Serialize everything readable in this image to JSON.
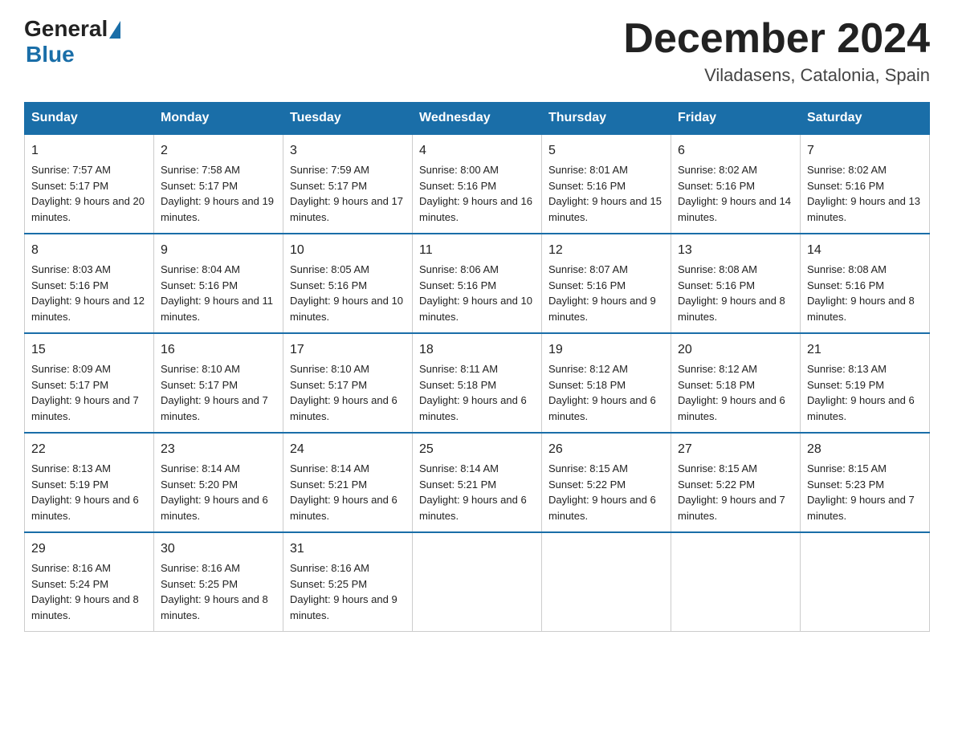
{
  "header": {
    "logo_general": "General",
    "logo_blue": "Blue",
    "month_title": "December 2024",
    "location": "Viladasens, Catalonia, Spain"
  },
  "days_of_week": [
    "Sunday",
    "Monday",
    "Tuesday",
    "Wednesday",
    "Thursday",
    "Friday",
    "Saturday"
  ],
  "weeks": [
    [
      {
        "day": "1",
        "sunrise": "7:57 AM",
        "sunset": "5:17 PM",
        "daylight": "9 hours and 20 minutes."
      },
      {
        "day": "2",
        "sunrise": "7:58 AM",
        "sunset": "5:17 PM",
        "daylight": "9 hours and 19 minutes."
      },
      {
        "day": "3",
        "sunrise": "7:59 AM",
        "sunset": "5:17 PM",
        "daylight": "9 hours and 17 minutes."
      },
      {
        "day": "4",
        "sunrise": "8:00 AM",
        "sunset": "5:16 PM",
        "daylight": "9 hours and 16 minutes."
      },
      {
        "day": "5",
        "sunrise": "8:01 AM",
        "sunset": "5:16 PM",
        "daylight": "9 hours and 15 minutes."
      },
      {
        "day": "6",
        "sunrise": "8:02 AM",
        "sunset": "5:16 PM",
        "daylight": "9 hours and 14 minutes."
      },
      {
        "day": "7",
        "sunrise": "8:02 AM",
        "sunset": "5:16 PM",
        "daylight": "9 hours and 13 minutes."
      }
    ],
    [
      {
        "day": "8",
        "sunrise": "8:03 AM",
        "sunset": "5:16 PM",
        "daylight": "9 hours and 12 minutes."
      },
      {
        "day": "9",
        "sunrise": "8:04 AM",
        "sunset": "5:16 PM",
        "daylight": "9 hours and 11 minutes."
      },
      {
        "day": "10",
        "sunrise": "8:05 AM",
        "sunset": "5:16 PM",
        "daylight": "9 hours and 10 minutes."
      },
      {
        "day": "11",
        "sunrise": "8:06 AM",
        "sunset": "5:16 PM",
        "daylight": "9 hours and 10 minutes."
      },
      {
        "day": "12",
        "sunrise": "8:07 AM",
        "sunset": "5:16 PM",
        "daylight": "9 hours and 9 minutes."
      },
      {
        "day": "13",
        "sunrise": "8:08 AM",
        "sunset": "5:16 PM",
        "daylight": "9 hours and 8 minutes."
      },
      {
        "day": "14",
        "sunrise": "8:08 AM",
        "sunset": "5:16 PM",
        "daylight": "9 hours and 8 minutes."
      }
    ],
    [
      {
        "day": "15",
        "sunrise": "8:09 AM",
        "sunset": "5:17 PM",
        "daylight": "9 hours and 7 minutes."
      },
      {
        "day": "16",
        "sunrise": "8:10 AM",
        "sunset": "5:17 PM",
        "daylight": "9 hours and 7 minutes."
      },
      {
        "day": "17",
        "sunrise": "8:10 AM",
        "sunset": "5:17 PM",
        "daylight": "9 hours and 6 minutes."
      },
      {
        "day": "18",
        "sunrise": "8:11 AM",
        "sunset": "5:18 PM",
        "daylight": "9 hours and 6 minutes."
      },
      {
        "day": "19",
        "sunrise": "8:12 AM",
        "sunset": "5:18 PM",
        "daylight": "9 hours and 6 minutes."
      },
      {
        "day": "20",
        "sunrise": "8:12 AM",
        "sunset": "5:18 PM",
        "daylight": "9 hours and 6 minutes."
      },
      {
        "day": "21",
        "sunrise": "8:13 AM",
        "sunset": "5:19 PM",
        "daylight": "9 hours and 6 minutes."
      }
    ],
    [
      {
        "day": "22",
        "sunrise": "8:13 AM",
        "sunset": "5:19 PM",
        "daylight": "9 hours and 6 minutes."
      },
      {
        "day": "23",
        "sunrise": "8:14 AM",
        "sunset": "5:20 PM",
        "daylight": "9 hours and 6 minutes."
      },
      {
        "day": "24",
        "sunrise": "8:14 AM",
        "sunset": "5:21 PM",
        "daylight": "9 hours and 6 minutes."
      },
      {
        "day": "25",
        "sunrise": "8:14 AM",
        "sunset": "5:21 PM",
        "daylight": "9 hours and 6 minutes."
      },
      {
        "day": "26",
        "sunrise": "8:15 AM",
        "sunset": "5:22 PM",
        "daylight": "9 hours and 6 minutes."
      },
      {
        "day": "27",
        "sunrise": "8:15 AM",
        "sunset": "5:22 PM",
        "daylight": "9 hours and 7 minutes."
      },
      {
        "day": "28",
        "sunrise": "8:15 AM",
        "sunset": "5:23 PM",
        "daylight": "9 hours and 7 minutes."
      }
    ],
    [
      {
        "day": "29",
        "sunrise": "8:16 AM",
        "sunset": "5:24 PM",
        "daylight": "9 hours and 8 minutes."
      },
      {
        "day": "30",
        "sunrise": "8:16 AM",
        "sunset": "5:25 PM",
        "daylight": "9 hours and 8 minutes."
      },
      {
        "day": "31",
        "sunrise": "8:16 AM",
        "sunset": "5:25 PM",
        "daylight": "9 hours and 9 minutes."
      },
      null,
      null,
      null,
      null
    ]
  ],
  "labels": {
    "sunrise": "Sunrise:",
    "sunset": "Sunset:",
    "daylight": "Daylight:"
  }
}
